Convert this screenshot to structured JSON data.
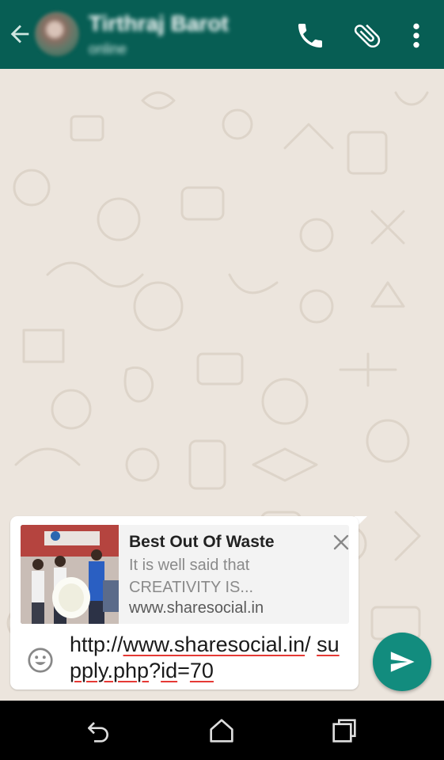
{
  "header": {
    "contact_name": "Tirthraj Barot",
    "contact_status": "online",
    "icons": {
      "back": "arrow-back-icon",
      "call": "phone-icon",
      "attach": "paperclip-icon",
      "menu": "more-vert-icon"
    }
  },
  "link_preview": {
    "title": "Best Out Of Waste",
    "description": "It is well said that CREATIVITY IS...",
    "url": "www.sharesocial.in",
    "close_icon": "close-icon"
  },
  "composer": {
    "text_part1": "http://",
    "text_part2": "www.sharesocial.in",
    "text_part3": "/ ",
    "text_part4": "supply.php",
    "text_part5": "?",
    "text_part6": "id",
    "text_part7": "=",
    "text_part8": "70",
    "emoji_icon": "emoji-icon",
    "send_icon": "send-icon"
  },
  "navigation": {
    "back_icon": "nav-back-icon",
    "home_icon": "nav-home-icon",
    "recents_icon": "nav-recents-icon"
  },
  "colors": {
    "primary": "#075e54",
    "accent": "#128c7e",
    "chat_background": "#ece5dd",
    "spellcheck": "#e53935"
  }
}
